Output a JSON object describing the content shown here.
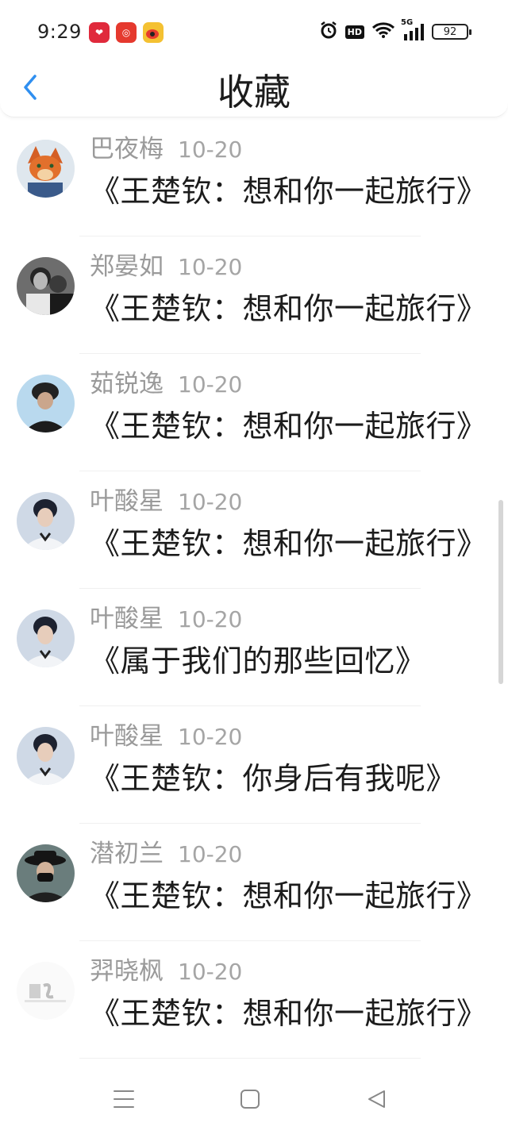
{
  "status_bar": {
    "time": "9:29",
    "battery": "92",
    "hd": "HD",
    "network": "5G"
  },
  "header": {
    "title": "收藏"
  },
  "items": [
    {
      "name": "巴夜梅",
      "date": "10-20",
      "title": "《王楚钦：想和你一起旅行》",
      "avatar": "fox-avatar"
    },
    {
      "name": "郑晏如",
      "date": "10-20",
      "title": "《王楚钦：想和你一起旅行》",
      "avatar": "bw-photo-avatar"
    },
    {
      "name": "茹锐逸",
      "date": "10-20",
      "title": "《王楚钦：想和你一起旅行》",
      "avatar": "hat-avatar"
    },
    {
      "name": "叶酸星",
      "date": "10-20",
      "title": "《王楚钦：想和你一起旅行》",
      "avatar": "person-avatar"
    },
    {
      "name": "叶酸星",
      "date": "10-20",
      "title": "《属于我们的那些回忆》",
      "avatar": "person-avatar"
    },
    {
      "name": "叶酸星",
      "date": "10-20",
      "title": "《王楚钦：你身后有我呢》",
      "avatar": "person-avatar"
    },
    {
      "name": "潜初兰",
      "date": "10-20",
      "title": "《王楚钦：想和你一起旅行》",
      "avatar": "mask-avatar"
    },
    {
      "name": "羿晓枫",
      "date": "10-20",
      "title": "《王楚钦：想和你一起旅行》",
      "avatar": "light-avatar"
    }
  ],
  "colors": {
    "accent": "#2f8ff0",
    "secondary_text": "#9a9a9a",
    "primary_text": "#1c1c1c"
  }
}
